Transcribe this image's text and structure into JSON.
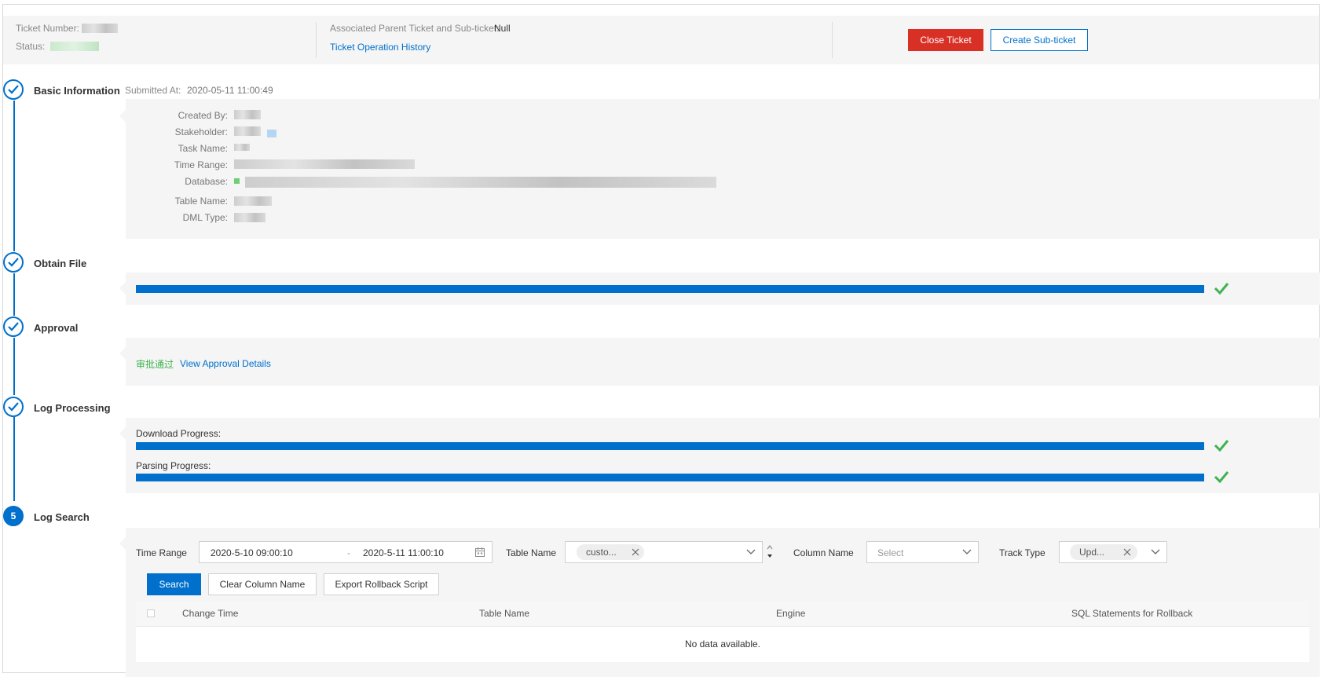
{
  "header": {
    "ticket_number_label": "Ticket Number:",
    "status_label": "Status:",
    "associated_label": "Associated Parent Ticket and Sub-ticket:",
    "associated_value": "Null",
    "operation_history_link": "Ticket Operation History",
    "close_ticket_button": "Close Ticket",
    "create_subticket_button": "Create Sub-ticket"
  },
  "steps": {
    "basic_information": {
      "title": "Basic Information",
      "submitted_at_label": "Submitted At:",
      "submitted_at_value": "2020-05-11 11:00:49",
      "fields": {
        "created_by": "Created By:",
        "stakeholder": "Stakeholder:",
        "task_name": "Task Name:",
        "time_range": "Time Range:",
        "database": "Database:",
        "table_name": "Table Name:",
        "dml_type": "DML Type:"
      }
    },
    "obtain_file": {
      "title": "Obtain File",
      "progress": 1.0
    },
    "approval": {
      "title": "Approval",
      "status_text": "审批通过",
      "details_link": "View Approval Details"
    },
    "log_processing": {
      "title": "Log Processing",
      "download_label": "Download Progress:",
      "download_progress": 1.0,
      "parsing_label": "Parsing Progress:",
      "parsing_progress": 1.0
    },
    "log_search": {
      "number": "5",
      "title": "Log Search",
      "time_range_label": "Time Range",
      "time_start": "2020-5-10 09:00:10",
      "time_separator": "-",
      "time_end": "2020-5-11 11:00:10",
      "table_name_label": "Table Name",
      "table_name_tag": "custo...",
      "column_name_label": "Column Name",
      "column_name_placeholder": "Select",
      "track_type_label": "Track Type",
      "track_type_tag": "Upd...",
      "search_button": "Search",
      "clear_button": "Clear Column Name",
      "export_button": "Export Rollback Script",
      "table": {
        "columns": [
          "Change Time",
          "Table Name",
          "Engine",
          "SQL Statements for Rollback"
        ],
        "empty_text": "No data available."
      }
    }
  },
  "colors": {
    "primary": "#0070cc",
    "danger": "#d93026",
    "success": "#3eb34f",
    "panel_bg": "#f5f5f5"
  }
}
